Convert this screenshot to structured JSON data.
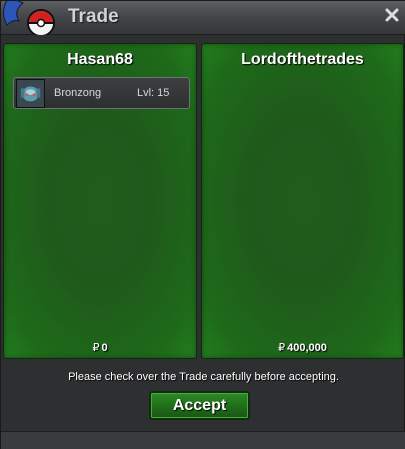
{
  "window": {
    "title": "Trade",
    "logo_icon": "pokeball-logo-icon",
    "close_icon": "close-icon"
  },
  "left_panel": {
    "trainer": "Hasan68",
    "pokemon": [
      {
        "name": "Bronzong",
        "level": "Lvl: 15",
        "sprite_icon": "bronzong-sprite-icon"
      }
    ],
    "money_symbol": "₽",
    "money": "0"
  },
  "right_panel": {
    "trainer": "Lordofthetrades",
    "pokemon": [],
    "money_symbol": "₽",
    "money": "400,000"
  },
  "notice": "Please check over the Trade carefully before accepting.",
  "accept_label": "Accept",
  "colors": {
    "panel_green": "#1f5a1b",
    "button_green": "#1f6d19",
    "titlebar": "#404245"
  }
}
